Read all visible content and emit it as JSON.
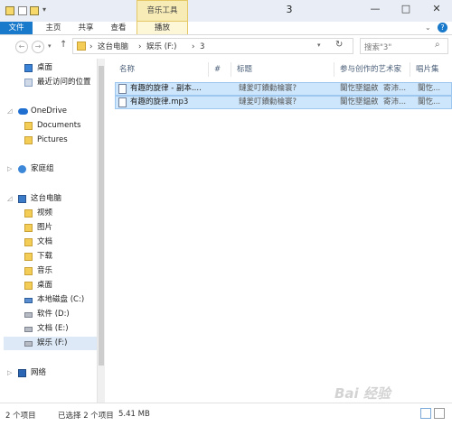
{
  "window": {
    "title": "3",
    "context_tab": "音乐工具",
    "min": "—",
    "max": "□",
    "close": "✕"
  },
  "ribbon": {
    "tabs": [
      "文件",
      "主页",
      "共享",
      "查看",
      "播放"
    ]
  },
  "address": {
    "crumbs": [
      "这台电脑",
      "娱乐 (F:)",
      "3"
    ],
    "separator": "›",
    "search_placeholder": "搜索\"3\""
  },
  "nav": {
    "favorites": [
      "桌面",
      "最近访问的位置"
    ],
    "onedrive": "OneDrive",
    "onedrive_children": [
      "Documents",
      "Pictures"
    ],
    "homegroup": "家庭组",
    "thispc": "这台电脑",
    "thispc_children": [
      "视频",
      "图片",
      "文档",
      "下载",
      "音乐",
      "桌面"
    ],
    "drives": [
      "本地磁盘 (C:)",
      "软件 (D:)",
      "文档 (E:)",
      "娱乐 (F:)"
    ],
    "network": "网络"
  },
  "columns": [
    "名称",
    "#",
    "标题",
    "参与创作的艺术家",
    "唱片集"
  ],
  "files": [
    {
      "name": "有趣的旋律 - 副本....",
      "title": "鏈夎叮鐨勬棆寰?",
      "artist": "闅忔墜鎾斂",
      "artist2": "寄沛...",
      "album": "闅忔..."
    },
    {
      "name": "有趣的旋律.mp3",
      "title": "鏈夎叮鐨勬棆寰?",
      "artist": "闅忔墜鎾斂",
      "artist2": "寄沛...",
      "album": "闅忔..."
    }
  ],
  "status": {
    "count": "2 个项目",
    "selected": "已选择 2 个项目",
    "size": "5.41 MB"
  },
  "watermark": "Bai 经验",
  "colors": {
    "accent": "#1979ca",
    "selection": "#cde6fb",
    "context": "#f7ecb6"
  }
}
